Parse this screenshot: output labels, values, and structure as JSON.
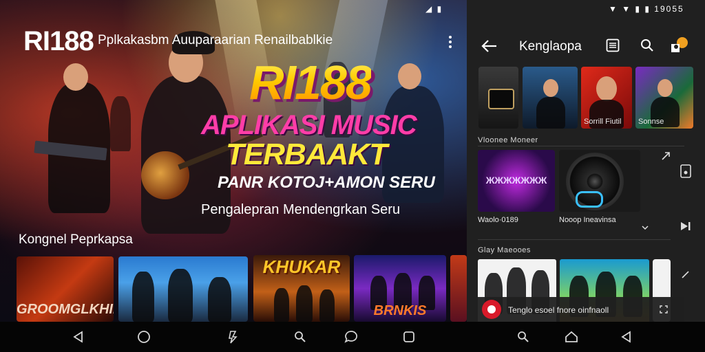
{
  "status_bar": {
    "left_icons": "◢ ▮",
    "right_time": "19055"
  },
  "left": {
    "logo": "RI188",
    "tagline": "Pplkakasbm Auuparaarian Renailbablkie",
    "hero": {
      "title": "RI188",
      "line1": "APLIKASI MUSIC",
      "line2": "TERBAAKT",
      "line3": "PANR KOTOJ+AMON SERU",
      "line4": "Pengalepran Mendengrkan Seru"
    },
    "section_title": "Kongnel Peprkapsa",
    "thumbnails": [
      {
        "label": "GROOMGLKHIE"
      },
      {
        "label": ""
      },
      {
        "label": "KHUKAR"
      },
      {
        "label": "BRNKIS"
      },
      {
        "label": ""
      }
    ]
  },
  "right": {
    "header_title": "Kenglaopa",
    "section1_label": "Vloonee Moneer",
    "top_row_captions": [
      "",
      "",
      "Sorrill Fiutil",
      "Sonnse"
    ],
    "section1_caption_left": "Waolo·0189",
    "section1_caption_right": "Nooop Ineavinsa",
    "section2_label": "Glay Maeooes",
    "now_playing_text": "Tenglo esoel fnore oinfnaoll"
  },
  "nav": {
    "left_icons": [
      "back-triangle",
      "home-circle",
      "app-swirl",
      "search",
      "chat-bubble",
      "recents-square"
    ],
    "right_icons": [
      "search",
      "home-house",
      "back-triangle"
    ]
  },
  "colors": {
    "accent_yellow": "#ffd21a",
    "accent_pink": "#ff3da8",
    "panel_dark": "#202020",
    "nav_bg": "#050505"
  }
}
